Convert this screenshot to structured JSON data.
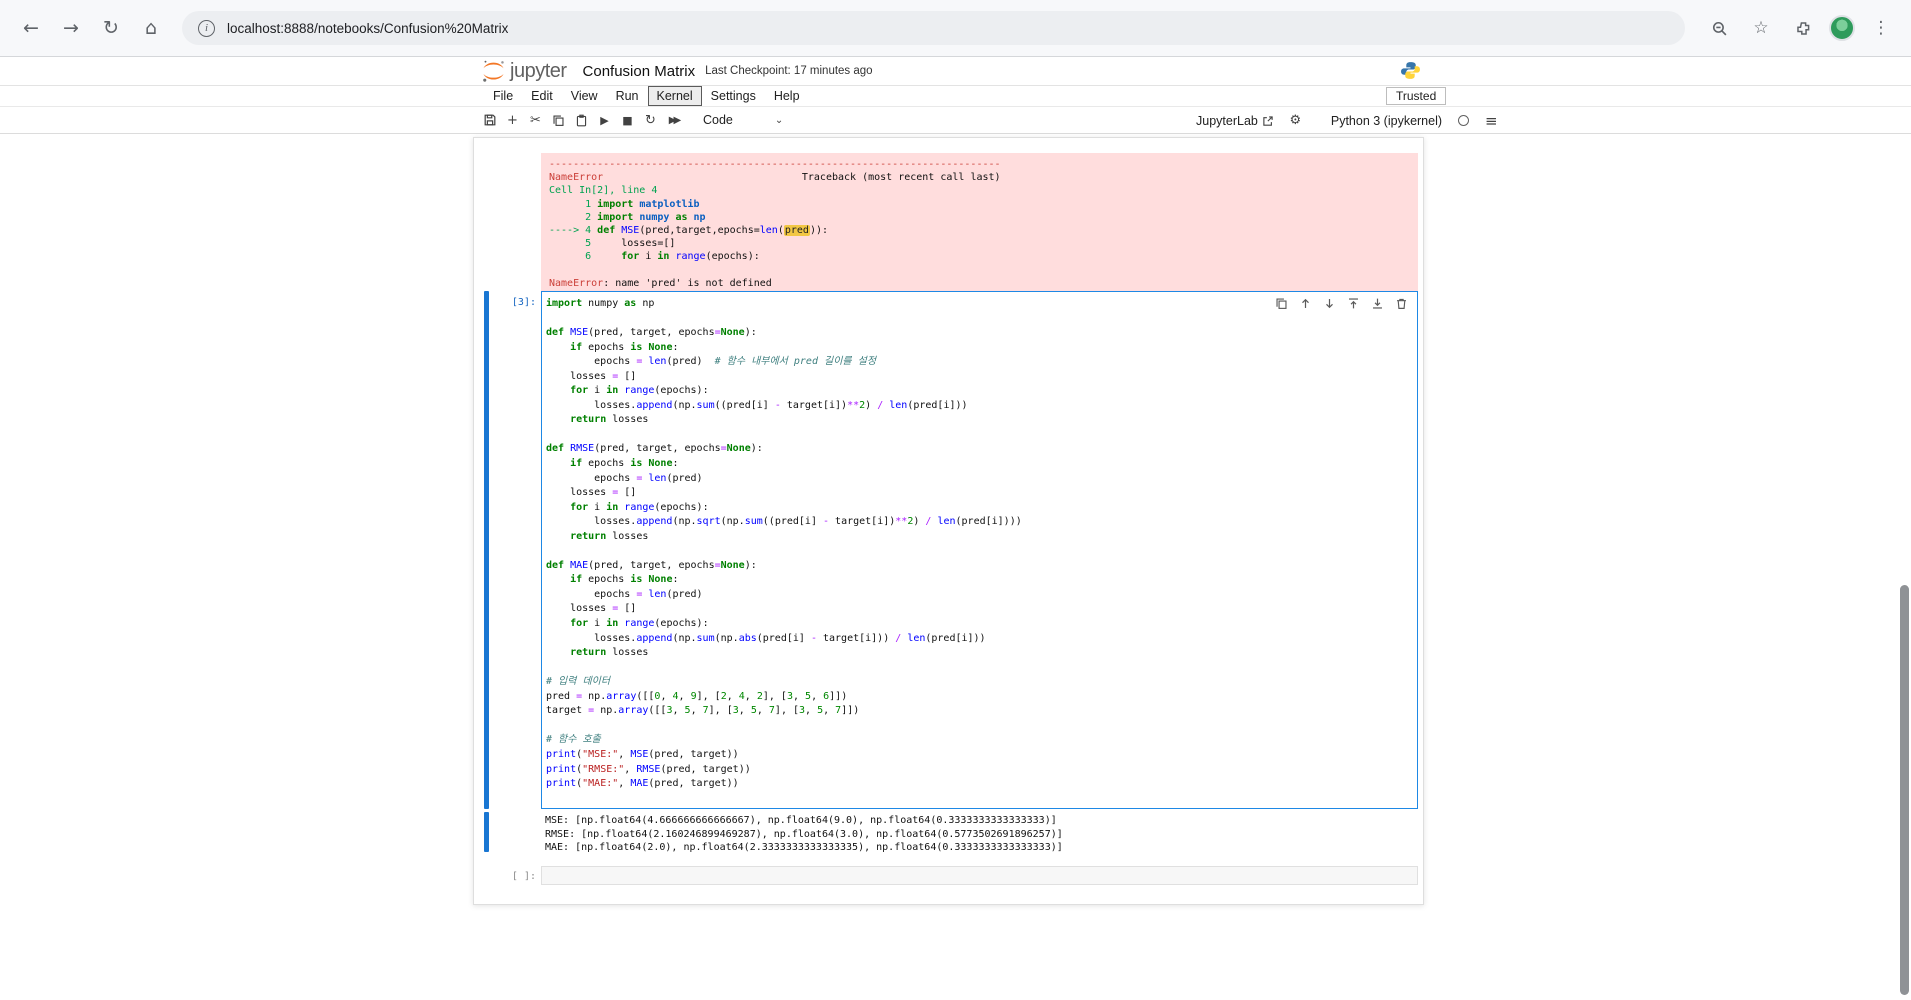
{
  "browser": {
    "url": "localhost:8888/notebooks/Confusion%20Matrix"
  },
  "icons": {
    "back": "←",
    "forward": "→",
    "reload": "↻",
    "home": "⌂",
    "info": "i",
    "star": "☆",
    "kebab": "⋮",
    "cut": "✂",
    "run": "▶",
    "stop": "■",
    "restart": "↻",
    "ffwd": "▶▶",
    "plus": "+",
    "gear": "⚙",
    "hamburger": "≡",
    "caret_down": "⌄"
  },
  "header": {
    "wordmark": "jupyter",
    "title": "Confusion Matrix",
    "checkpoint": "Last Checkpoint: 17 minutes ago"
  },
  "menubar": {
    "items": [
      "File",
      "Edit",
      "View",
      "Run",
      "Kernel",
      "Settings",
      "Help"
    ],
    "active_item": "Kernel",
    "trusted": "Trusted"
  },
  "toolbar": {
    "cell_type": "Code",
    "jupyterlab_label": "JupyterLab",
    "kernel_label": "Python 3 (ipykernel)"
  },
  "cells": {
    "error_output": {
      "lines": [
        [
          [
            "r",
            "---------------------------------------------------------------------------"
          ]
        ],
        [
          [
            "r",
            "NameError"
          ],
          [
            "p",
            "                                 Traceback (most recent call last)"
          ]
        ],
        [
          [
            "g",
            "Cell In[2], line 4"
          ]
        ],
        [
          [
            "g",
            "      1 "
          ],
          [
            "k",
            "import"
          ],
          [
            "m",
            " matplotlib"
          ]
        ],
        [
          [
            "g",
            "      2 "
          ],
          [
            "k",
            "import"
          ],
          [
            "m",
            " numpy"
          ],
          [
            "p",
            " "
          ],
          [
            "k",
            "as"
          ],
          [
            "m",
            " np"
          ]
        ],
        [
          [
            "g",
            "----> 4 "
          ],
          [
            "k",
            "def"
          ],
          [
            "p",
            " "
          ],
          [
            "f",
            "MSE"
          ],
          [
            "p",
            "(pred,target,epochs="
          ],
          [
            "f",
            "len"
          ],
          [
            "p",
            "("
          ],
          [
            "h",
            "pred"
          ],
          [
            "p",
            ")):"
          ]
        ],
        [
          [
            "g",
            "      5     "
          ],
          [
            "p",
            "losses=[]"
          ]
        ],
        [
          [
            "g",
            "      6     "
          ],
          [
            "k",
            "for"
          ],
          [
            "p",
            " i "
          ],
          [
            "k",
            "in"
          ],
          [
            "p",
            " "
          ],
          [
            "f",
            "range"
          ],
          [
            "p",
            "(epochs):"
          ]
        ],
        [],
        [
          [
            "r",
            "NameError"
          ],
          [
            "p",
            ": name 'pred' is not defined"
          ]
        ]
      ]
    },
    "code": {
      "prompt": "[3]:",
      "lines": [
        [
          [
            "k",
            "import"
          ],
          [
            "p",
            " numpy "
          ],
          [
            "k",
            "as"
          ],
          [
            "p",
            " np"
          ]
        ],
        [],
        [
          [
            "k",
            "def"
          ],
          [
            "p",
            " "
          ],
          [
            "f",
            "MSE"
          ],
          [
            "p",
            "(pred, target, epochs"
          ],
          [
            "o",
            "="
          ],
          [
            "k",
            "None"
          ],
          [
            "p",
            "):"
          ]
        ],
        [
          [
            "p",
            "    "
          ],
          [
            "k",
            "if"
          ],
          [
            "p",
            " epochs "
          ],
          [
            "k",
            "is"
          ],
          [
            "p",
            " "
          ],
          [
            "k",
            "None"
          ],
          [
            "p",
            ":"
          ]
        ],
        [
          [
            "p",
            "        epochs "
          ],
          [
            "o",
            "="
          ],
          [
            "p",
            " "
          ],
          [
            "f",
            "len"
          ],
          [
            "p",
            "(pred)  "
          ],
          [
            "c",
            "# 함수 내부에서 pred 길이를 설정"
          ]
        ],
        [
          [
            "p",
            "    losses "
          ],
          [
            "o",
            "="
          ],
          [
            "p",
            " []"
          ]
        ],
        [
          [
            "p",
            "    "
          ],
          [
            "k",
            "for"
          ],
          [
            "p",
            " i "
          ],
          [
            "k",
            "in"
          ],
          [
            "p",
            " "
          ],
          [
            "f",
            "range"
          ],
          [
            "p",
            "(epochs):"
          ]
        ],
        [
          [
            "p",
            "        losses."
          ],
          [
            "f",
            "append"
          ],
          [
            "p",
            "(np."
          ],
          [
            "f",
            "sum"
          ],
          [
            "p",
            "((pred[i] "
          ],
          [
            "o",
            "-"
          ],
          [
            "p",
            " target[i])"
          ],
          [
            "o",
            "**"
          ],
          [
            "n",
            "2"
          ],
          [
            "p",
            ") "
          ],
          [
            "o",
            "/"
          ],
          [
            "p",
            " "
          ],
          [
            "f",
            "len"
          ],
          [
            "p",
            "(pred[i]))"
          ]
        ],
        [
          [
            "p",
            "    "
          ],
          [
            "k",
            "return"
          ],
          [
            "p",
            " losses"
          ]
        ],
        [],
        [
          [
            "k",
            "def"
          ],
          [
            "p",
            " "
          ],
          [
            "f",
            "RMSE"
          ],
          [
            "p",
            "(pred, target, epochs"
          ],
          [
            "o",
            "="
          ],
          [
            "k",
            "None"
          ],
          [
            "p",
            "):"
          ]
        ],
        [
          [
            "p",
            "    "
          ],
          [
            "k",
            "if"
          ],
          [
            "p",
            " epochs "
          ],
          [
            "k",
            "is"
          ],
          [
            "p",
            " "
          ],
          [
            "k",
            "None"
          ],
          [
            "p",
            ":"
          ]
        ],
        [
          [
            "p",
            "        epochs "
          ],
          [
            "o",
            "="
          ],
          [
            "p",
            " "
          ],
          [
            "f",
            "len"
          ],
          [
            "p",
            "(pred)"
          ]
        ],
        [
          [
            "p",
            "    losses "
          ],
          [
            "o",
            "="
          ],
          [
            "p",
            " []"
          ]
        ],
        [
          [
            "p",
            "    "
          ],
          [
            "k",
            "for"
          ],
          [
            "p",
            " i "
          ],
          [
            "k",
            "in"
          ],
          [
            "p",
            " "
          ],
          [
            "f",
            "range"
          ],
          [
            "p",
            "(epochs):"
          ]
        ],
        [
          [
            "p",
            "        losses."
          ],
          [
            "f",
            "append"
          ],
          [
            "p",
            "(np."
          ],
          [
            "f",
            "sqrt"
          ],
          [
            "p",
            "(np."
          ],
          [
            "f",
            "sum"
          ],
          [
            "p",
            "((pred[i] "
          ],
          [
            "o",
            "-"
          ],
          [
            "p",
            " target[i])"
          ],
          [
            "o",
            "**"
          ],
          [
            "n",
            "2"
          ],
          [
            "p",
            ") "
          ],
          [
            "o",
            "/"
          ],
          [
            "p",
            " "
          ],
          [
            "f",
            "len"
          ],
          [
            "p",
            "(pred[i])))"
          ]
        ],
        [
          [
            "p",
            "    "
          ],
          [
            "k",
            "return"
          ],
          [
            "p",
            " losses"
          ]
        ],
        [],
        [
          [
            "k",
            "def"
          ],
          [
            "p",
            " "
          ],
          [
            "f",
            "MAE"
          ],
          [
            "p",
            "(pred, target, epochs"
          ],
          [
            "o",
            "="
          ],
          [
            "k",
            "None"
          ],
          [
            "p",
            "):"
          ]
        ],
        [
          [
            "p",
            "    "
          ],
          [
            "k",
            "if"
          ],
          [
            "p",
            " epochs "
          ],
          [
            "k",
            "is"
          ],
          [
            "p",
            " "
          ],
          [
            "k",
            "None"
          ],
          [
            "p",
            ":"
          ]
        ],
        [
          [
            "p",
            "        epochs "
          ],
          [
            "o",
            "="
          ],
          [
            "p",
            " "
          ],
          [
            "f",
            "len"
          ],
          [
            "p",
            "(pred)"
          ]
        ],
        [
          [
            "p",
            "    losses "
          ],
          [
            "o",
            "="
          ],
          [
            "p",
            " []"
          ]
        ],
        [
          [
            "p",
            "    "
          ],
          [
            "k",
            "for"
          ],
          [
            "p",
            " i "
          ],
          [
            "k",
            "in"
          ],
          [
            "p",
            " "
          ],
          [
            "f",
            "range"
          ],
          [
            "p",
            "(epochs):"
          ]
        ],
        [
          [
            "p",
            "        losses."
          ],
          [
            "f",
            "append"
          ],
          [
            "p",
            "(np."
          ],
          [
            "f",
            "sum"
          ],
          [
            "p",
            "(np."
          ],
          [
            "f",
            "abs"
          ],
          [
            "p",
            "(pred[i] "
          ],
          [
            "o",
            "-"
          ],
          [
            "p",
            " target[i])) "
          ],
          [
            "o",
            "/"
          ],
          [
            "p",
            " "
          ],
          [
            "f",
            "len"
          ],
          [
            "p",
            "(pred[i]))"
          ]
        ],
        [
          [
            "p",
            "    "
          ],
          [
            "k",
            "return"
          ],
          [
            "p",
            " losses"
          ]
        ],
        [],
        [
          [
            "c",
            "# 입력 데이터"
          ]
        ],
        [
          [
            "p",
            "pred "
          ],
          [
            "o",
            "="
          ],
          [
            "p",
            " np."
          ],
          [
            "f",
            "array"
          ],
          [
            "p",
            "([["
          ],
          [
            "n",
            "0"
          ],
          [
            "p",
            ", "
          ],
          [
            "n",
            "4"
          ],
          [
            "p",
            ", "
          ],
          [
            "n",
            "9"
          ],
          [
            "p",
            "], ["
          ],
          [
            "n",
            "2"
          ],
          [
            "p",
            ", "
          ],
          [
            "n",
            "4"
          ],
          [
            "p",
            ", "
          ],
          [
            "n",
            "2"
          ],
          [
            "p",
            "], ["
          ],
          [
            "n",
            "3"
          ],
          [
            "p",
            ", "
          ],
          [
            "n",
            "5"
          ],
          [
            "p",
            ", "
          ],
          [
            "n",
            "6"
          ],
          [
            "p",
            "]])"
          ]
        ],
        [
          [
            "p",
            "target "
          ],
          [
            "o",
            "="
          ],
          [
            "p",
            " np."
          ],
          [
            "f",
            "array"
          ],
          [
            "p",
            "([["
          ],
          [
            "n",
            "3"
          ],
          [
            "p",
            ", "
          ],
          [
            "n",
            "5"
          ],
          [
            "p",
            ", "
          ],
          [
            "n",
            "7"
          ],
          [
            "p",
            "], ["
          ],
          [
            "n",
            "3"
          ],
          [
            "p",
            ", "
          ],
          [
            "n",
            "5"
          ],
          [
            "p",
            ", "
          ],
          [
            "n",
            "7"
          ],
          [
            "p",
            "], ["
          ],
          [
            "n",
            "3"
          ],
          [
            "p",
            ", "
          ],
          [
            "n",
            "5"
          ],
          [
            "p",
            ", "
          ],
          [
            "n",
            "7"
          ],
          [
            "p",
            "]])"
          ]
        ],
        [],
        [
          [
            "c",
            "# 함수 호출"
          ]
        ],
        [
          [
            "f",
            "print"
          ],
          [
            "p",
            "("
          ],
          [
            "s",
            "\"MSE:\""
          ],
          [
            "p",
            ", "
          ],
          [
            "f",
            "MSE"
          ],
          [
            "p",
            "(pred, target))"
          ]
        ],
        [
          [
            "f",
            "print"
          ],
          [
            "p",
            "("
          ],
          [
            "s",
            "\"RMSE:\""
          ],
          [
            "p",
            ", "
          ],
          [
            "f",
            "RMSE"
          ],
          [
            "p",
            "(pred, target))"
          ]
        ],
        [
          [
            "f",
            "print"
          ],
          [
            "p",
            "("
          ],
          [
            "s",
            "\"MAE:\""
          ],
          [
            "p",
            ", "
          ],
          [
            "f",
            "MAE"
          ],
          [
            "p",
            "(pred, target))"
          ]
        ]
      ]
    },
    "output": {
      "lines": [
        "MSE: [np.float64(4.666666666666667), np.float64(9.0), np.float64(0.3333333333333333)]",
        "RMSE: [np.float64(2.160246899469287), np.float64(3.0), np.float64(0.5773502691896257)]",
        "MAE: [np.float64(2.0), np.float64(2.3333333333333335), np.float64(0.3333333333333333)]"
      ]
    },
    "empty": {
      "prompt": "[ ]:"
    }
  }
}
